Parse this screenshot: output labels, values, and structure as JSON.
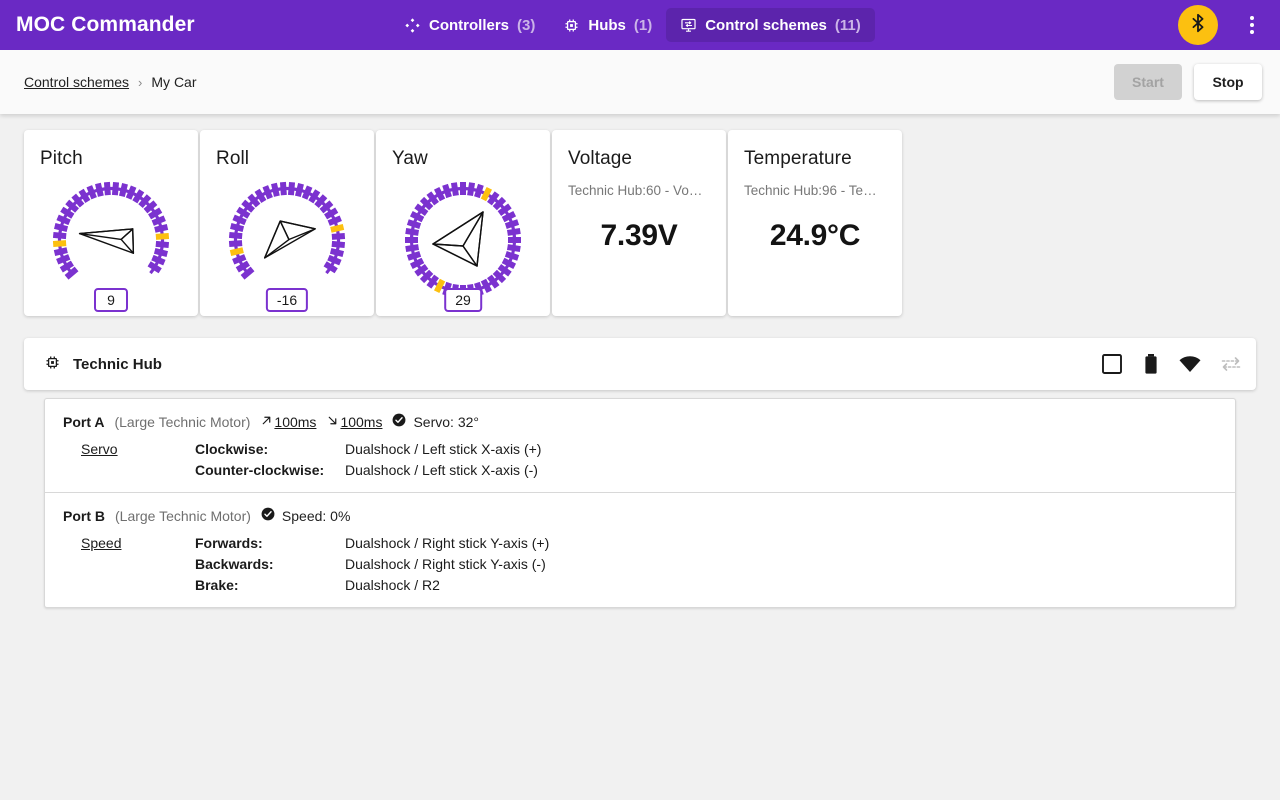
{
  "app": {
    "brand": "MOC Commander",
    "nav": [
      {
        "label": "Controllers",
        "count": "(3)",
        "icon": "gamepad-icon",
        "active": false
      },
      {
        "label": "Hubs",
        "count": "(1)",
        "icon": "chip-icon",
        "active": false
      },
      {
        "label": "Control schemes",
        "count": "(11)",
        "icon": "control-scheme-icon",
        "active": true
      }
    ],
    "bluetooth_icon": "bluetooth-icon",
    "menu_icon": "overflow-menu-icon",
    "accent": "#6a29c4",
    "accent_dark": "#5c24ac",
    "bluetooth_bg": "#fcc010"
  },
  "toolbar": {
    "breadcrumb_root": "Control schemes",
    "breadcrumb_sep": "›",
    "breadcrumb_current": "My Car",
    "start_label": "Start",
    "stop_label": "Stop"
  },
  "cards": {
    "pitch": {
      "title": "Pitch",
      "value": "9"
    },
    "roll": {
      "title": "Roll",
      "value": "-16"
    },
    "yaw": {
      "title": "Yaw",
      "value": "29"
    },
    "voltage": {
      "title": "Voltage",
      "subtitle": "Technic Hub:60 - Vo…",
      "value": "7.39V"
    },
    "temperature": {
      "title": "Temperature",
      "subtitle": "Technic Hub:96 - Te…",
      "value": "24.9°C"
    }
  },
  "hub": {
    "icon": "chip-icon",
    "name": "Technic Hub",
    "actions": [
      {
        "name": "stop-square-icon"
      },
      {
        "name": "battery-icon"
      },
      {
        "name": "signal-icon"
      },
      {
        "name": "sync-icon"
      }
    ]
  },
  "ports": [
    {
      "name": "Port A",
      "device": "(Large Technic Motor)",
      "ramp_up": "100ms",
      "ramp_down": "100ms",
      "state": "Servo: 32°",
      "mode": "Servo",
      "bindings": [
        {
          "label": "Clockwise:",
          "value": "Dualshock / Left stick X-axis (+)"
        },
        {
          "label": "Counter-clockwise:",
          "value": "Dualshock / Left stick X-axis (-)"
        }
      ]
    },
    {
      "name": "Port B",
      "device": "(Large Technic Motor)",
      "state": "Speed: 0%",
      "mode": "Speed",
      "bindings": [
        {
          "label": "Forwards:",
          "value": "Dualshock / Right stick Y-axis (+)"
        },
        {
          "label": "Backwards:",
          "value": "Dualshock / Right stick Y-axis (-)"
        },
        {
          "label": "Brake:",
          "value": "Dualshock / R2"
        }
      ]
    }
  ],
  "gauges": {
    "tick_color": "#7b32cf",
    "marker_color": "#fcc010",
    "pitch": {
      "value": 9,
      "start_angle": -130,
      "end_angle": 130,
      "markers": [
        90,
        270
      ]
    },
    "roll": {
      "value": -16,
      "start_angle": -130,
      "end_angle": 130,
      "markers": [
        74,
        254
      ]
    },
    "yaw": {
      "value": 29,
      "start_angle": 0,
      "end_angle": 360,
      "markers": [
        29,
        209
      ]
    }
  }
}
